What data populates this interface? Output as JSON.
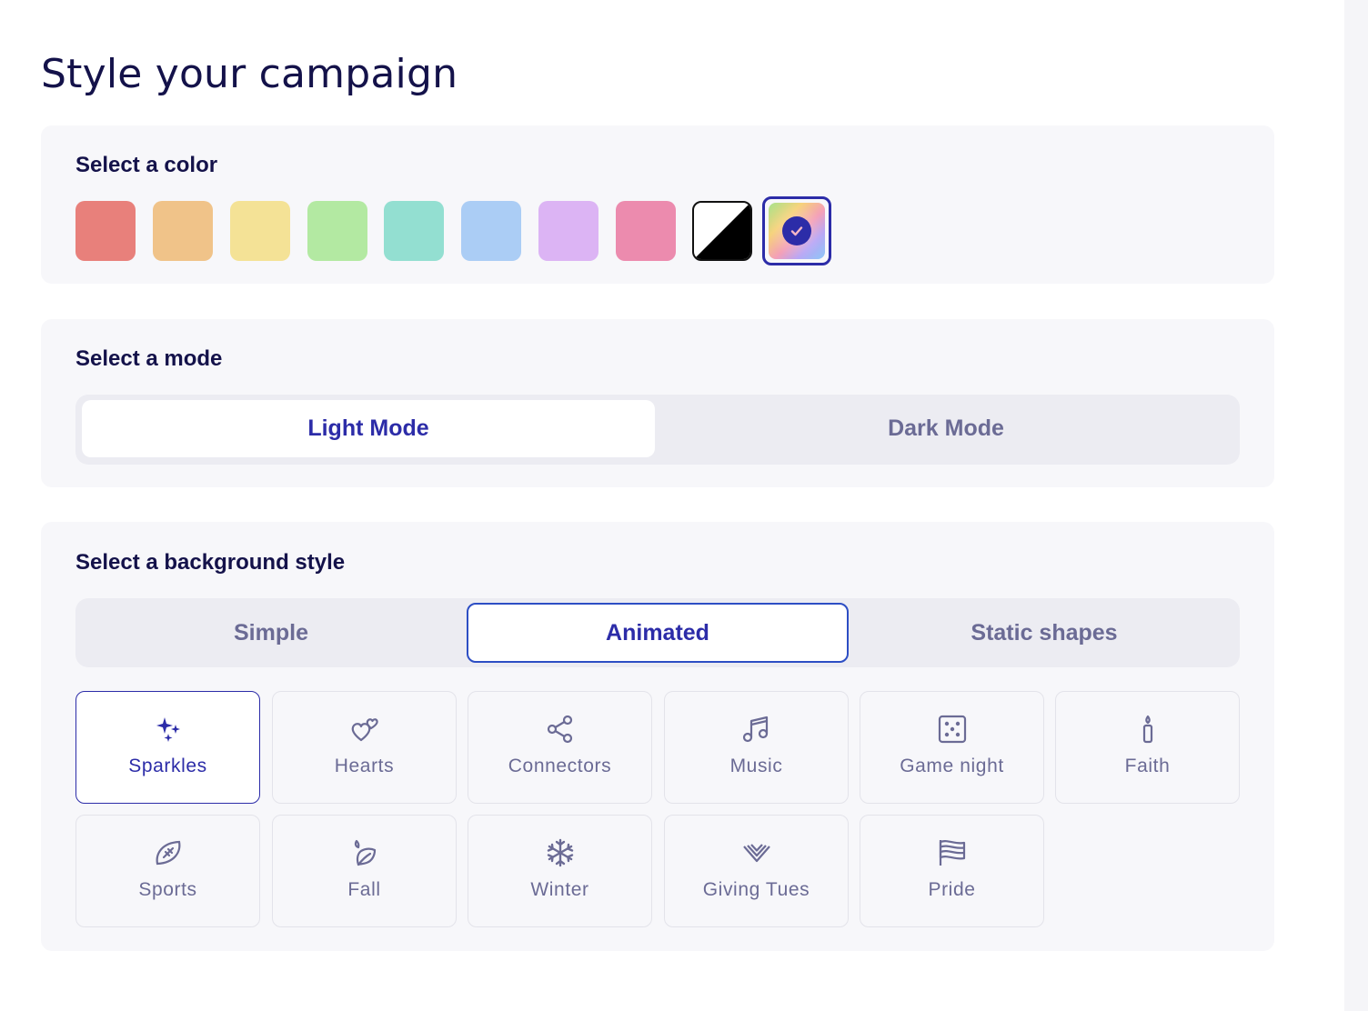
{
  "page": {
    "title": "Style your campaign"
  },
  "color_section": {
    "label": "Select a color",
    "swatches": [
      {
        "name": "red",
        "color": "#e8807b"
      },
      {
        "name": "orange",
        "color": "#f0c389"
      },
      {
        "name": "yellow",
        "color": "#f4e296"
      },
      {
        "name": "green",
        "color": "#b3e9a2"
      },
      {
        "name": "teal",
        "color": "#93dfd1"
      },
      {
        "name": "blue",
        "color": "#abcdf5"
      },
      {
        "name": "purple",
        "color": "#dcb4f4"
      },
      {
        "name": "pink",
        "color": "#ec8bae"
      },
      {
        "name": "black-white",
        "color": "#000000"
      },
      {
        "name": "rainbow",
        "color": "gradient",
        "selected": true
      }
    ],
    "accent": "#2c2ca8"
  },
  "mode_section": {
    "label": "Select a mode",
    "options": [
      {
        "label": "Light Mode",
        "selected": true
      },
      {
        "label": "Dark Mode",
        "selected": false
      }
    ]
  },
  "background_section": {
    "label": "Select a background style",
    "tabs": [
      {
        "label": "Simple",
        "selected": false
      },
      {
        "label": "Animated",
        "selected": true
      },
      {
        "label": "Static shapes",
        "selected": false
      }
    ],
    "styles": [
      {
        "label": "Sparkles",
        "icon": "sparkles-icon",
        "selected": true
      },
      {
        "label": "Hearts",
        "icon": "hearts-icon",
        "selected": false
      },
      {
        "label": "Connectors",
        "icon": "share-nodes-icon",
        "selected": false
      },
      {
        "label": "Music",
        "icon": "music-note-icon",
        "selected": false
      },
      {
        "label": "Game night",
        "icon": "dice-icon",
        "selected": false
      },
      {
        "label": "Faith",
        "icon": "candle-icon",
        "selected": false
      },
      {
        "label": "Sports",
        "icon": "football-icon",
        "selected": false
      },
      {
        "label": "Fall",
        "icon": "leaf-icon",
        "selected": false
      },
      {
        "label": "Winter",
        "icon": "snowflake-icon",
        "selected": false
      },
      {
        "label": "Giving Tues",
        "icon": "giving-tuesday-heart-icon",
        "selected": false
      },
      {
        "label": "Pride",
        "icon": "flag-icon",
        "selected": false
      }
    ]
  }
}
